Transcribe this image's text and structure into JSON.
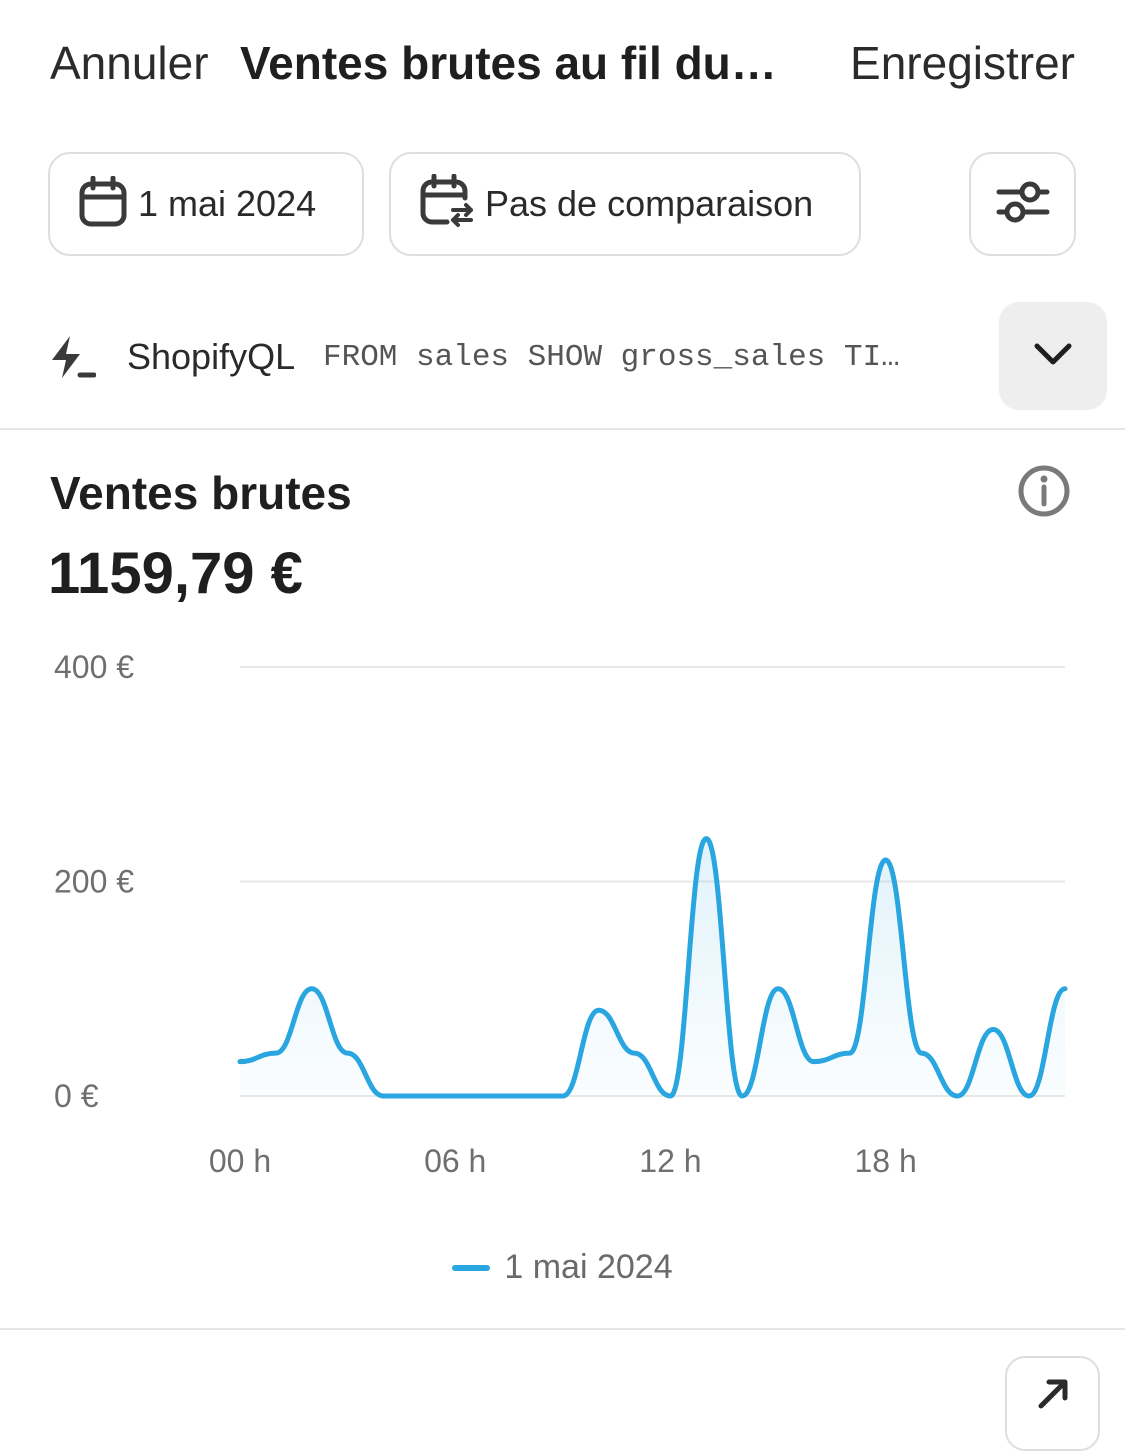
{
  "header": {
    "cancel_label": "Annuler",
    "title": "Ventes brutes au fil du…",
    "save_label": "Enregistrer"
  },
  "filters": {
    "date_label": "1 mai 2024",
    "comparison_label": "Pas de comparaison",
    "date_icon": "calendar-icon",
    "comparison_icon": "calendar-compare-icon",
    "settings_icon": "sliders-icon"
  },
  "query": {
    "icon": "bolt-icon",
    "label": "ShopifyQL",
    "code": "FROM sales SHOW gross_sales TI…",
    "expand_icon": "chevron-down-icon"
  },
  "metric": {
    "title": "Ventes brutes",
    "value": "1159,79 €",
    "info_icon": "info-icon"
  },
  "chart_data": {
    "type": "area",
    "x": [
      "00 h",
      "01 h",
      "02 h",
      "03 h",
      "04 h",
      "05 h",
      "06 h",
      "07 h",
      "08 h",
      "09 h",
      "10 h",
      "11 h",
      "12 h",
      "13 h",
      "14 h",
      "15 h",
      "16 h",
      "17 h",
      "18 h",
      "19 h",
      "20 h",
      "21 h",
      "22 h",
      "23 h"
    ],
    "x_tick_labels": [
      "00 h",
      "06 h",
      "12 h",
      "18 h"
    ],
    "y_tick_labels": [
      "0 €",
      "200 €",
      "400 €"
    ],
    "ylim": [
      0,
      400
    ],
    "grid": true,
    "legend_position": "bottom-center",
    "series": [
      {
        "name": "1 mai 2024",
        "color": "#29a5e0",
        "values": [
          32,
          40,
          100,
          40,
          0,
          0,
          0,
          0,
          0,
          0,
          80,
          40,
          0,
          240,
          0,
          100,
          32,
          40,
          220,
          40,
          0,
          62,
          0,
          100
        ]
      }
    ]
  },
  "legend": {
    "label": "1 mai 2024"
  },
  "footer": {
    "open_icon": "arrow-up-right-icon"
  }
}
